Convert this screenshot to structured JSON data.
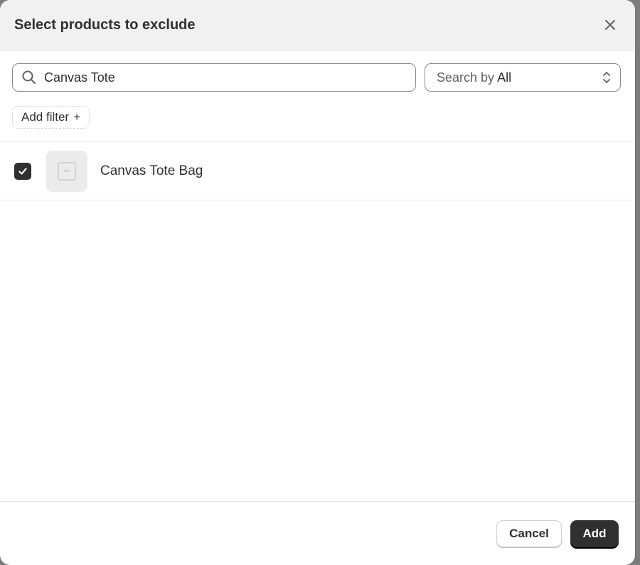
{
  "modal": {
    "title": "Select products to exclude",
    "close_icon": "close-icon"
  },
  "search": {
    "value": "Canvas Tote",
    "icon": "search-icon"
  },
  "search_by": {
    "label": "Search by",
    "value": "All",
    "icon": "chevron-up-down-icon"
  },
  "filter": {
    "add_label": "Add filter",
    "plus": "+"
  },
  "products": [
    {
      "name": "Canvas Tote Bag",
      "checked": true
    }
  ],
  "footer": {
    "cancel_label": "Cancel",
    "add_label": "Add"
  },
  "colors": {
    "primary": "#303030",
    "header_bg": "#f1f1f1"
  }
}
